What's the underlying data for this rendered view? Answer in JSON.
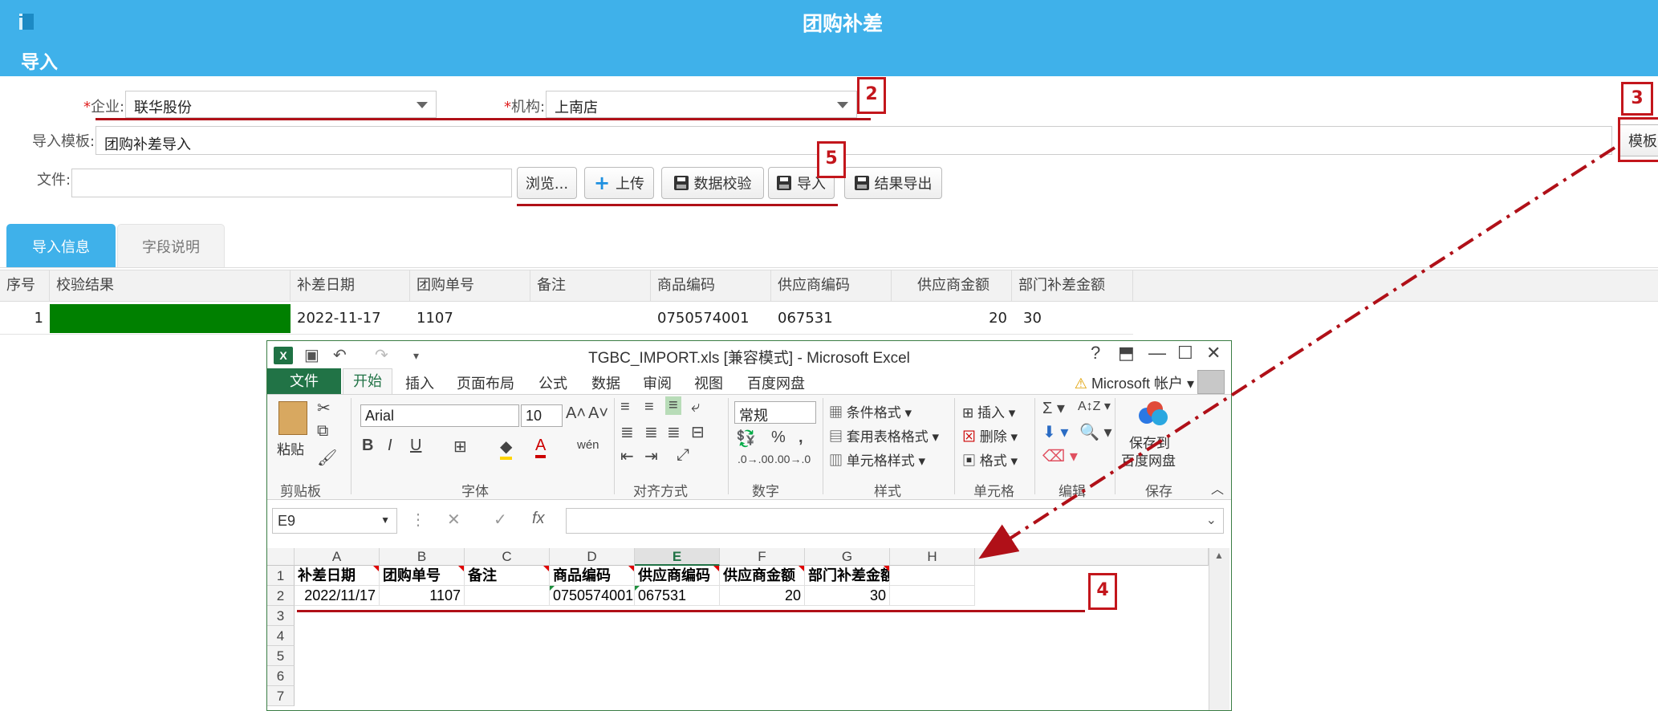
{
  "header": {
    "app_title": "团购补差",
    "section_title": "导入"
  },
  "form": {
    "company_label": "企业:",
    "company_value": "联华股份",
    "org_label": "机构:",
    "org_value": "上南店",
    "template_label": "导入模板:",
    "template_value": "团购补差导入",
    "template_button": "模板",
    "file_label": "文件:",
    "file_value": "",
    "buttons": {
      "browse": "浏览...",
      "upload": "上传",
      "validate": "数据校验",
      "import": "导入",
      "export": "结果导出"
    }
  },
  "tabs": [
    "导入信息",
    "字段说明"
  ],
  "grid": {
    "columns": [
      "序号",
      "校验结果",
      "补差日期",
      "团购单号",
      "备注",
      "商品编码",
      "供应商编码",
      "供应商金额",
      "部门补差金额"
    ],
    "rows": [
      {
        "no": "1",
        "result_color": "#008000",
        "date": "2022-11-17",
        "order": "1107",
        "note": "",
        "product": "0750574001",
        "supplier": "067531",
        "supplier_amount": "20",
        "dept_amount": "30"
      }
    ]
  },
  "excel": {
    "caption": "TGBC_IMPORT.xls  [兼容模式] - Microsoft Excel",
    "menu": [
      "文件",
      "开始",
      "插入",
      "页面布局",
      "公式",
      "数据",
      "审阅",
      "视图",
      "百度网盘"
    ],
    "account": "Microsoft 帐户",
    "ribbon": {
      "paste": "粘贴",
      "font_name": "Arial",
      "font_size": "10",
      "number_format": "常规",
      "cond_format": "条件格式",
      "table_format": "套用表格格式",
      "cell_style": "单元格样式",
      "insert": "插入",
      "delete": "删除",
      "format": "格式",
      "save_to": "保存到",
      "baidu_disk": "百度网盘",
      "groups": [
        "剪贴板",
        "字体",
        "对齐方式",
        "数字",
        "样式",
        "单元格",
        "编辑",
        "保存"
      ]
    },
    "name_box": "E9",
    "col_letters": [
      "A",
      "B",
      "C",
      "D",
      "E",
      "F",
      "G",
      "H"
    ],
    "row_numbers": [
      "1",
      "2",
      "3",
      "4",
      "5",
      "6",
      "7"
    ],
    "header_row": [
      "补差日期",
      "团购单号",
      "备注",
      "商品编码",
      "供应商编码",
      "供应商金额",
      "部门补差金额"
    ],
    "data_row": [
      "2022/11/17",
      "1107",
      "",
      "0750574001",
      "067531",
      "20",
      "30"
    ]
  },
  "annotations": {
    "m2": "2",
    "m3": "3",
    "m4": "4",
    "m5": "5"
  },
  "colors": {
    "header_bg": "#3fb1ea",
    "accent_red": "#c3161c",
    "excel_green": "#217346"
  }
}
